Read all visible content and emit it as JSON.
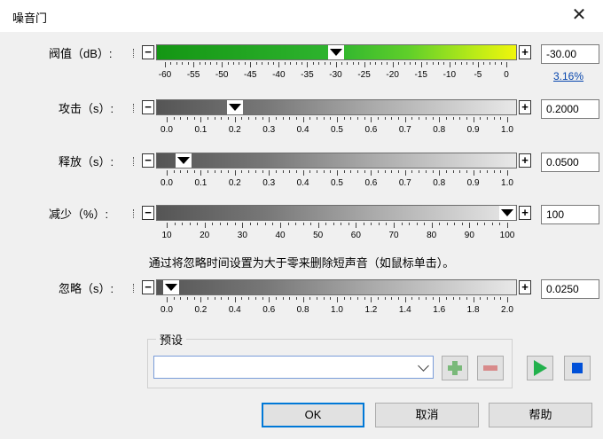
{
  "window": {
    "title": "噪音门",
    "close_glyph": "✕"
  },
  "controls": {
    "minus_glyph": "−",
    "plus_glyph": "+"
  },
  "threshold": {
    "label": "阀值（dB）:",
    "value": "-30.00",
    "link": "3.16%",
    "ticks": [
      "-60",
      "-55",
      "-50",
      "-45",
      "-40",
      "-35",
      "-30",
      "-25",
      "-20",
      "-15",
      "-10",
      "-5",
      "0"
    ],
    "slider_value": -30,
    "colors": {
      "left": "#1aa01a",
      "right": "#e4f10a"
    }
  },
  "attack": {
    "label": "攻击（s）:",
    "value": "0.2000",
    "ticks": [
      "0.0",
      "0.1",
      "0.2",
      "0.3",
      "0.4",
      "0.5",
      "0.6",
      "0.7",
      "0.8",
      "0.9",
      "1.0"
    ],
    "slider_value": 0.2
  },
  "release": {
    "label": "释放（s）:",
    "value": "0.0500",
    "ticks": [
      "0.0",
      "0.1",
      "0.2",
      "0.3",
      "0.4",
      "0.5",
      "0.6",
      "0.7",
      "0.8",
      "0.9",
      "1.0"
    ],
    "slider_value": 0.05
  },
  "reduction": {
    "label": "减少（%）:",
    "value": "100",
    "ticks": [
      "10",
      "20",
      "30",
      "40",
      "50",
      "60",
      "70",
      "80",
      "90",
      "100"
    ],
    "slider_value": 100
  },
  "hint": "通过将忽略时间设置为大于零来删除短声音（如鼠标单击）。",
  "ignore": {
    "label": "忽略（s）:",
    "value": "0.0250",
    "ticks": [
      "0.0",
      "0.2",
      "0.4",
      "0.6",
      "0.8",
      "1.0",
      "1.2",
      "1.4",
      "1.6",
      "1.8",
      "2.0"
    ],
    "slider_value": 0.025
  },
  "preset": {
    "group_label": "预设",
    "selected": "",
    "add_icon": "plus-icon",
    "remove_icon": "minus-icon",
    "play_icon": "play-icon",
    "stop_icon": "stop-icon"
  },
  "buttons": {
    "ok": "OK",
    "cancel": "取消",
    "help": "帮助"
  }
}
